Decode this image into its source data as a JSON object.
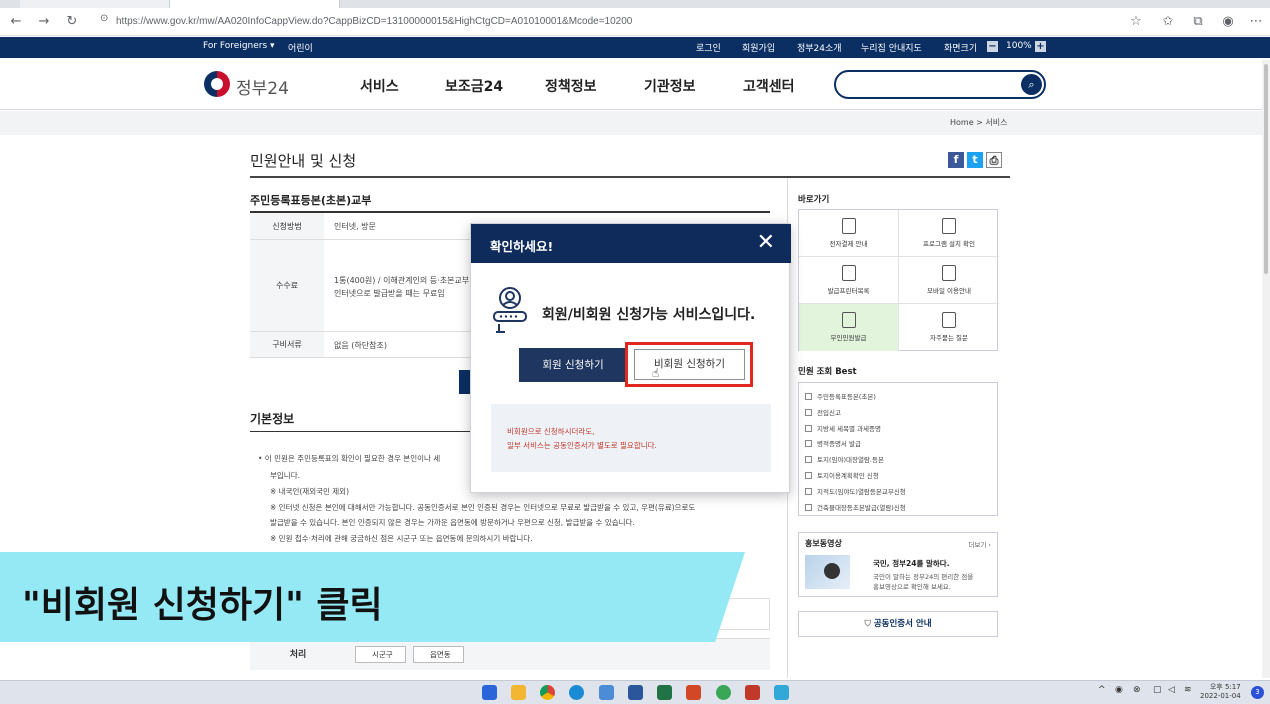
{
  "browser": {
    "url": "https://www.gov.kr/mw/AA020InfoCappView.do?CappBizCD=13100000015&HighCtgCD=A01010001&Mcode=10200"
  },
  "utility_bar": {
    "for_foreigners": "For Foreigners ▾",
    "kids": "어린이",
    "login": "로그인",
    "signup": "회원가입",
    "about": "정부24소개",
    "sitemap": "누리집 안내지도",
    "screen_size": "화면크기",
    "zoom": "100%"
  },
  "gnb": {
    "logo": "정부24",
    "menu": [
      "서비스",
      "보조금24",
      "정책정보",
      "기관정보",
      "고객센터"
    ]
  },
  "breadcrumb": "Home  >  서비스",
  "page": {
    "title": "민원안내 및 신청",
    "service_name": "주민등록표등본(초본)교부",
    "table": [
      {
        "label": "신청방법",
        "value": "인터넷, 방문"
      },
      {
        "label": "수수료",
        "value": "1통(400원) / 이해관계인의 등·초본교부"
      },
      {
        "label": "수수료_2",
        "value": "인터넷으로 발급받을 때는 무료임"
      },
      {
        "label": "구비서류",
        "value": "없음 (하단참조)"
      }
    ],
    "basic_info_title": "기본정보",
    "basic_info_lines": [
      "• 이 민원은 주민등록표의 확인이 필요한 경우 본인이나 세",
      "부입니다.",
      "※ 내국인(재외국민 제외)",
      "※ 인터넷 신청은 본인에 대해서만 가능합니다. 공동인증서로 본인 인증된 경우는 인터넷으로 무료로 발급받을 수 있고, 우편(유료)으로도",
      "발급받을 수 있습니다. 본인 인증되지 않은 경우는 가까운 읍면동에 방문하거나 우편으로 신청, 발급받을 수 있습니다.",
      "※ 민원 접수·처리에 관해 궁금하신 점은 시군구 또는 읍면동에 문의하시기 바랍니다."
    ],
    "process_label": "처리",
    "process_items": [
      "시군구",
      "읍면동"
    ]
  },
  "sidebar": {
    "quick_title": "바로가기",
    "quick_items": [
      "전자결제 안내",
      "프로그램 설치 확인",
      "발급프린터목록",
      "모바일 이용안내",
      "무인민원발급",
      "자주묻는 질문"
    ],
    "best_title": "민원 조회 Best",
    "best_items": [
      "주민등록표등본(초본)",
      "전입신고",
      "지방세 세목별 과세증명",
      "병적증명서 발급",
      "토지(임야)대장열람.등본",
      "토지이용계획확인 신청",
      "지적도(임야도)열람등본교부신청",
      "건축물대장등초본발급(열람)신청"
    ],
    "promo_title": "홍보동영상",
    "promo_more": "더보기 ›",
    "promo_headline": "국민, 정부24를 말하다.",
    "promo_desc_1": "국민이 말하는 정부24의 편리한 점을",
    "promo_desc_2": "홍보영상으로 확인해 보세요.",
    "cert_label": "공동인증서 안내"
  },
  "modal": {
    "title": "확인하세요!",
    "message": "회원/비회원 신청가능 서비스입니다.",
    "member_button": "회원 신청하기",
    "guest_button": "비회원 신청하기",
    "notice_1": "비회원으로 신청하시더라도,",
    "notice_2": "일부 서비스는 공동인증서가 별도로 필요합니다."
  },
  "caption": "\"비회원 신청하기\" 클릭",
  "taskbar": {
    "clock_time": "오후 5:17",
    "clock_date": "2022-01-04",
    "notification_count": "3"
  },
  "colors": {
    "navy": "#0f2b5b",
    "highlight_red": "#e0281e",
    "caption_cyan": "#8fe8f4"
  }
}
